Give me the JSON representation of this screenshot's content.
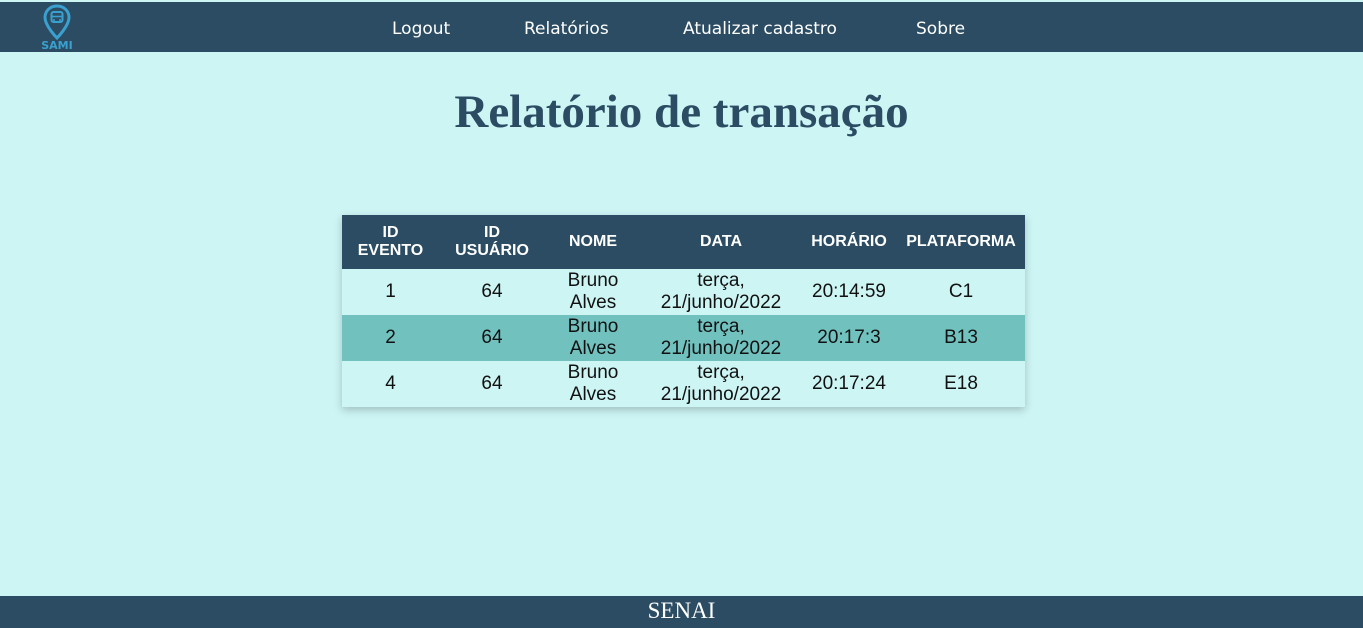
{
  "logo": {
    "text": "SAMI",
    "icon": "map-pin-bus-icon",
    "color": "#3aa0cf"
  },
  "nav": {
    "items": [
      {
        "label": "Logout"
      },
      {
        "label": "Relatórios"
      },
      {
        "label": "Atualizar cadastro"
      },
      {
        "label": "Sobre"
      }
    ]
  },
  "title": "Relatório de transação",
  "table": {
    "headers": [
      {
        "line1": "ID",
        "line2": "EVENTO"
      },
      {
        "line1": "ID",
        "line2": "USUÁRIO"
      },
      {
        "line1": "NOME",
        "line2": ""
      },
      {
        "line1": "DATA",
        "line2": ""
      },
      {
        "line1": "HORÁRIO",
        "line2": ""
      },
      {
        "line1": "PLATAFORMA",
        "line2": ""
      }
    ],
    "rows": [
      {
        "id_evento": "1",
        "id_usuario": "64",
        "nome_1": "Bruno",
        "nome_2": "Alves",
        "data_1": "terça,",
        "data_2": "21/junho/2022",
        "horario": "20:14:59",
        "plataforma": "C1"
      },
      {
        "id_evento": "2",
        "id_usuario": "64",
        "nome_1": "Bruno",
        "nome_2": "Alves",
        "data_1": "terça,",
        "data_2": "21/junho/2022",
        "horario": "20:17:3",
        "plataforma": "B13"
      },
      {
        "id_evento": "4",
        "id_usuario": "64",
        "nome_1": "Bruno",
        "nome_2": "Alves",
        "data_1": "terça,",
        "data_2": "21/junho/2022",
        "horario": "20:17:24",
        "plataforma": "E18"
      }
    ]
  },
  "footer": "SENAI",
  "colors": {
    "background": "#cdf5f4",
    "navbar": "#2b4c63",
    "row_alt": "#71c2bf"
  }
}
